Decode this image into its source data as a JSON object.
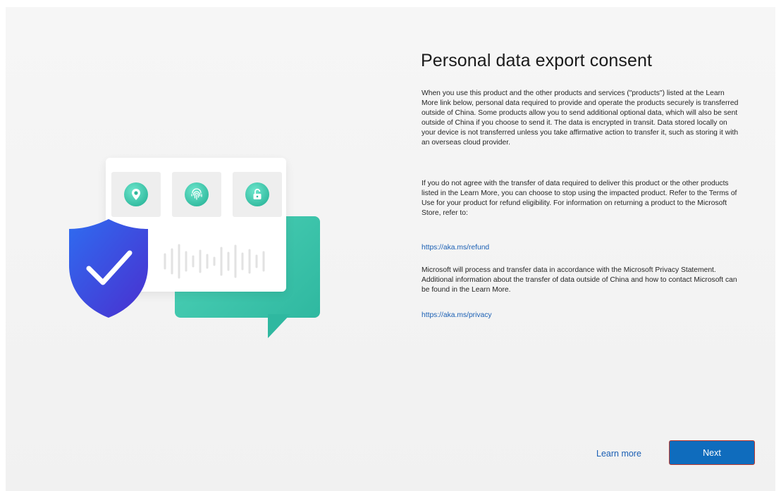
{
  "page": {
    "title": "Personal data export consent",
    "paragraphs": [
      "When you use this product and the other products and services (\"products\") listed at the Learn More link below, personal data required to provide and operate the products securely is transferred outside of China. Some products allow you to send additional optional data, which will also be sent outside of China if you choose to send it. The data is encrypted in transit. Data stored locally on your device is not transferred unless you take affirmative action to transfer it, such as storing it with an overseas cloud provider.",
      "If you do not agree with the transfer of data required to deliver this product or the other products listed in the Learn More, you can choose to stop using the impacted product. Refer to the Terms of Use for your product for refund eligibility. For information on returning a product to the Microsoft Store, refer to:",
      "Microsoft will process and transfer data in accordance with the Microsoft Privacy Statement. Additional information about the transfer of data outside of China and how to contact Microsoft can be found in the Learn More."
    ],
    "links": {
      "refund": "https://aka.ms/refund",
      "privacy": "https://aka.ms/privacy"
    }
  },
  "footer": {
    "learn_more_label": "Learn more",
    "next_label": "Next"
  },
  "illustration": {
    "icons": [
      "location-pin-icon",
      "fingerprint-icon",
      "unlock-icon",
      "shield-check-icon",
      "chat-bubble-icon",
      "audio-waveform-icon"
    ],
    "colors": {
      "teal": "#2fb8a0",
      "shield_blue": "#3448d6",
      "accent": "#0f6cbd"
    }
  }
}
